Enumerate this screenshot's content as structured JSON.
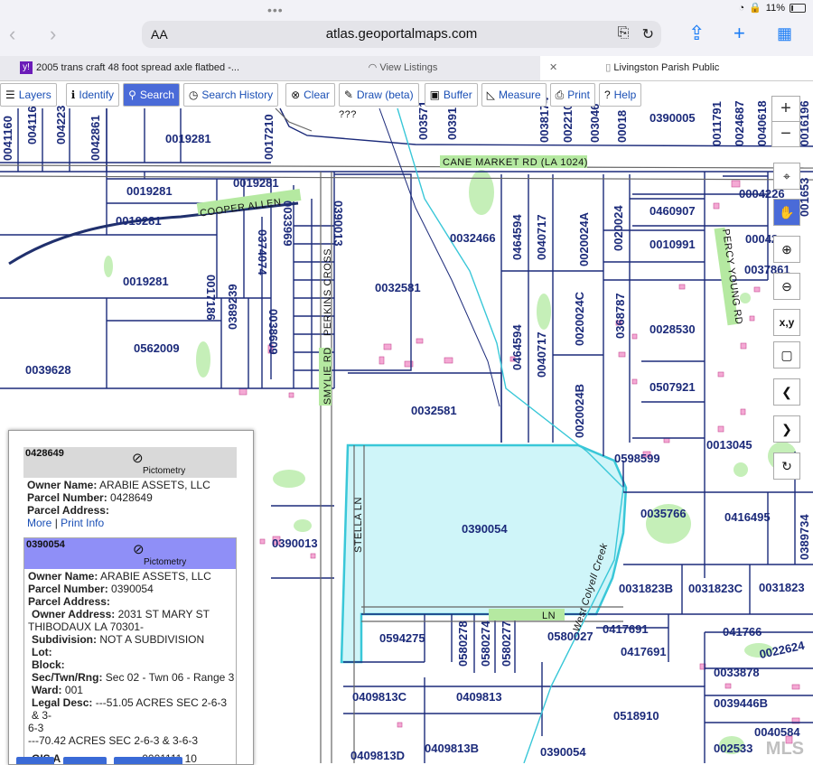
{
  "status": {
    "battery": "11%"
  },
  "browser": {
    "text_size": "AA",
    "url": "atlas.geoportalmaps.com"
  },
  "tabs": [
    {
      "label": "2005 trans craft 48 foot spread axle flatbed -..."
    },
    {
      "label": "View Listings"
    },
    {
      "label": "Livingston Parish Public"
    }
  ],
  "toolbar": {
    "layers": "Layers",
    "identify": "Identify",
    "search": "Search",
    "search_history": "Search History",
    "clear": "Clear",
    "draw": "Draw (beta)",
    "buffer": "Buffer",
    "measure": "Measure",
    "print": "Print",
    "help": "Help"
  },
  "map_controls": {
    "zoom_in": "+",
    "zoom_out": "−",
    "xy": "x,y"
  },
  "map": {
    "roads": {
      "cane_market": "CANE MARKET RD (LA 1024)",
      "cooper_allen": "COOPER ALLEN",
      "smylie": "SMYLIE RD",
      "perkins": "PERKINS CROSS",
      "stella": "STELLA LN",
      "bottom_road": "LN",
      "creek": "West Colyell Creek",
      "question": "???"
    },
    "parcels": {
      "p0041160": "0041160",
      "p0041165": "004116",
      "p0042238": "004223",
      "p0042861": "0042861",
      "p0019281a": "0019281",
      "p0019281b": "0019281",
      "p0019281c": "0019281",
      "p0019281d": "0019281",
      "p0017210": "0017210",
      "p0035710": "003571",
      "p0039100": "00391",
      "p0038174": "0038174",
      "p0022100": "002210",
      "p0030460": "003046",
      "p0018000": "00018",
      "p0390005": "0390005",
      "p0011791": "0011791",
      "p0024687": "0024687",
      "p0040618": "0040618",
      "p0016196": "0016196",
      "p0017186": "0017186",
      "p0374074": "0374074",
      "p0033969": "0033969",
      "p0390013a": "0390013",
      "p0389239": "0389239",
      "p0038609": "0038609",
      "p0562009": "0562009",
      "p0039628": "0039628",
      "p0032466": "0032466",
      "p0032581a": "0032581",
      "p0032581b": "0032581",
      "p0464594a": "0464594",
      "p0040717a": "0040717",
      "p0020024A": "0020024A",
      "p0020024": "0020024",
      "p0460907": "0460907",
      "p0010991": "0010991",
      "p0004226": "0004226",
      "p0004200": "00042",
      "p0037861": "0037861",
      "p0016532": "001653",
      "p0020024C": "0020024C",
      "p0368787": "0368787",
      "p0028530": "0028530",
      "p0464594b": "0464594",
      "p0040717b": "0040717",
      "p0020024B": "0020024B",
      "p0507921": "0507921",
      "p0013045": "0013045",
      "p0598599": "0598599",
      "p0390054a": "0390054",
      "p0035766": "0035766",
      "p0416495": "0416495",
      "p0389734": "0389734",
      "p0390013b": "0390013",
      "p0031823B": "0031823B",
      "p0031823C": "0031823C",
      "p0031823": "0031823",
      "p0594275": "0594275",
      "p0580278": "0580278",
      "p0580274": "0580274",
      "p0580277": "0580277",
      "p0580027": "0580027",
      "p0417691a": "0417691",
      "p0417691b": "0417691",
      "p0417664": "041766",
      "p0022624": "0022624",
      "p0033878": "0033878",
      "p0039446B": "0039446B",
      "p0409813C": "0409813C",
      "p0409813": "0409813",
      "p0518910": "0518910",
      "p0040584": "0040584",
      "p0025338": "002533",
      "p0409813D": "0409813D",
      "p0409813B": "0409813B",
      "p0390054b": "0390054"
    }
  },
  "popup": {
    "record1": {
      "id": "0428649",
      "pictometry": "Pictometry",
      "owner_label": "Owner Name:",
      "owner": "ARABIE ASSETS, LLC",
      "parcel_label": "Parcel Number:",
      "parcel": "0428649",
      "address_label": "Parcel Address:",
      "more": "More",
      "sep": "|",
      "print_info": "Print Info"
    },
    "record2": {
      "id": "0390054",
      "pictometry": "Pictometry",
      "owner_label": "Owner Name:",
      "owner": "ARABIE ASSETS, LLC",
      "parcel_label": "Parcel Number:",
      "parcel": "0390054",
      "address_label": "Parcel Address:",
      "owner_address_label": "Owner Address:",
      "owner_address1": "2031 ST MARY ST",
      "owner_address2": "THIBODAUX LA 70301-",
      "subdivision_label": "Subdivision:",
      "subdivision": "NOT A SUBDIVISION",
      "lot_label": "Lot:",
      "block_label": "Block:",
      "str_label": "Sec/Twn/Rng:",
      "str": "Sec 02 - Twn 06 - Range 3",
      "ward_label": "Ward:",
      "ward": "001",
      "legal_label": "Legal Desc:",
      "legal1": "---51.05 ACRES SEC 2-6-3 & 3-",
      "legal2": "6-3",
      "legal3": "---70.42 ACRES SEC 2-6-3 & 3-6-3",
      "gis_label": "GIS A",
      "gis_value": "0001111 10"
    }
  },
  "watermark": "MLS"
}
